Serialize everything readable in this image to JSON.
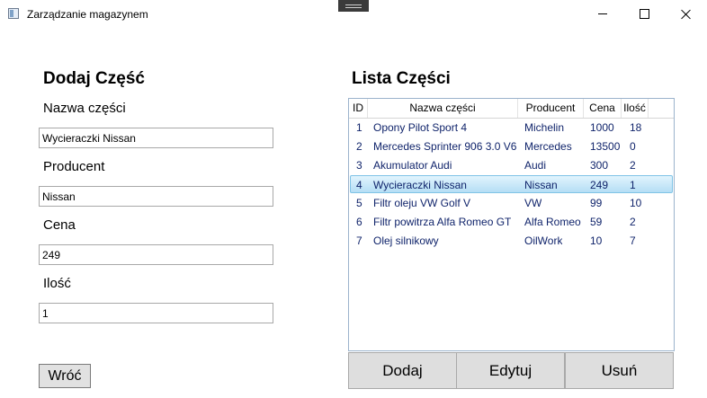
{
  "window": {
    "title": "Zarządzanie magazynem"
  },
  "form": {
    "heading": "Dodaj Część",
    "name_label": "Nazwa części",
    "name_value": "Wycieraczki Nissan",
    "producer_label": "Producent",
    "producer_value": "Nissan",
    "price_label": "Cena",
    "price_value": "249",
    "qty_label": "Ilość",
    "qty_value": "1",
    "back_label": "Wróć"
  },
  "list": {
    "heading": "Lista Części",
    "columns": {
      "id": "ID",
      "name": "Nazwa części",
      "producer": "Producent",
      "price": "Cena",
      "qty": "Ilość"
    },
    "rows": [
      {
        "id": "1",
        "name": "Opony Pilot Sport 4",
        "producer": "Michelin",
        "price": "1000",
        "qty": "18"
      },
      {
        "id": "2",
        "name": "Mercedes Sprinter 906 3.0 V6",
        "producer": "Mercedes",
        "price": "13500",
        "qty": "0"
      },
      {
        "id": "3",
        "name": "Akumulator Audi",
        "producer": "Audi",
        "price": "300",
        "qty": "2"
      },
      {
        "id": "4",
        "name": "Wycieraczki Nissan",
        "producer": "Nissan",
        "price": "249",
        "qty": "1"
      },
      {
        "id": "5",
        "name": "Filtr oleju VW Golf V",
        "producer": "VW",
        "price": "99",
        "qty": "10"
      },
      {
        "id": "6",
        "name": "Filtr powitrza Alfa Romeo GT",
        "producer": "Alfa Romeo",
        "price": "59",
        "qty": "2"
      },
      {
        "id": "7",
        "name": "Olej silnikowy",
        "producer": "OilWork",
        "price": "10",
        "qty": "7"
      }
    ],
    "selected_index": 3
  },
  "buttons": {
    "add": "Dodaj",
    "edit": "Edytuj",
    "delete": "Usuń"
  }
}
